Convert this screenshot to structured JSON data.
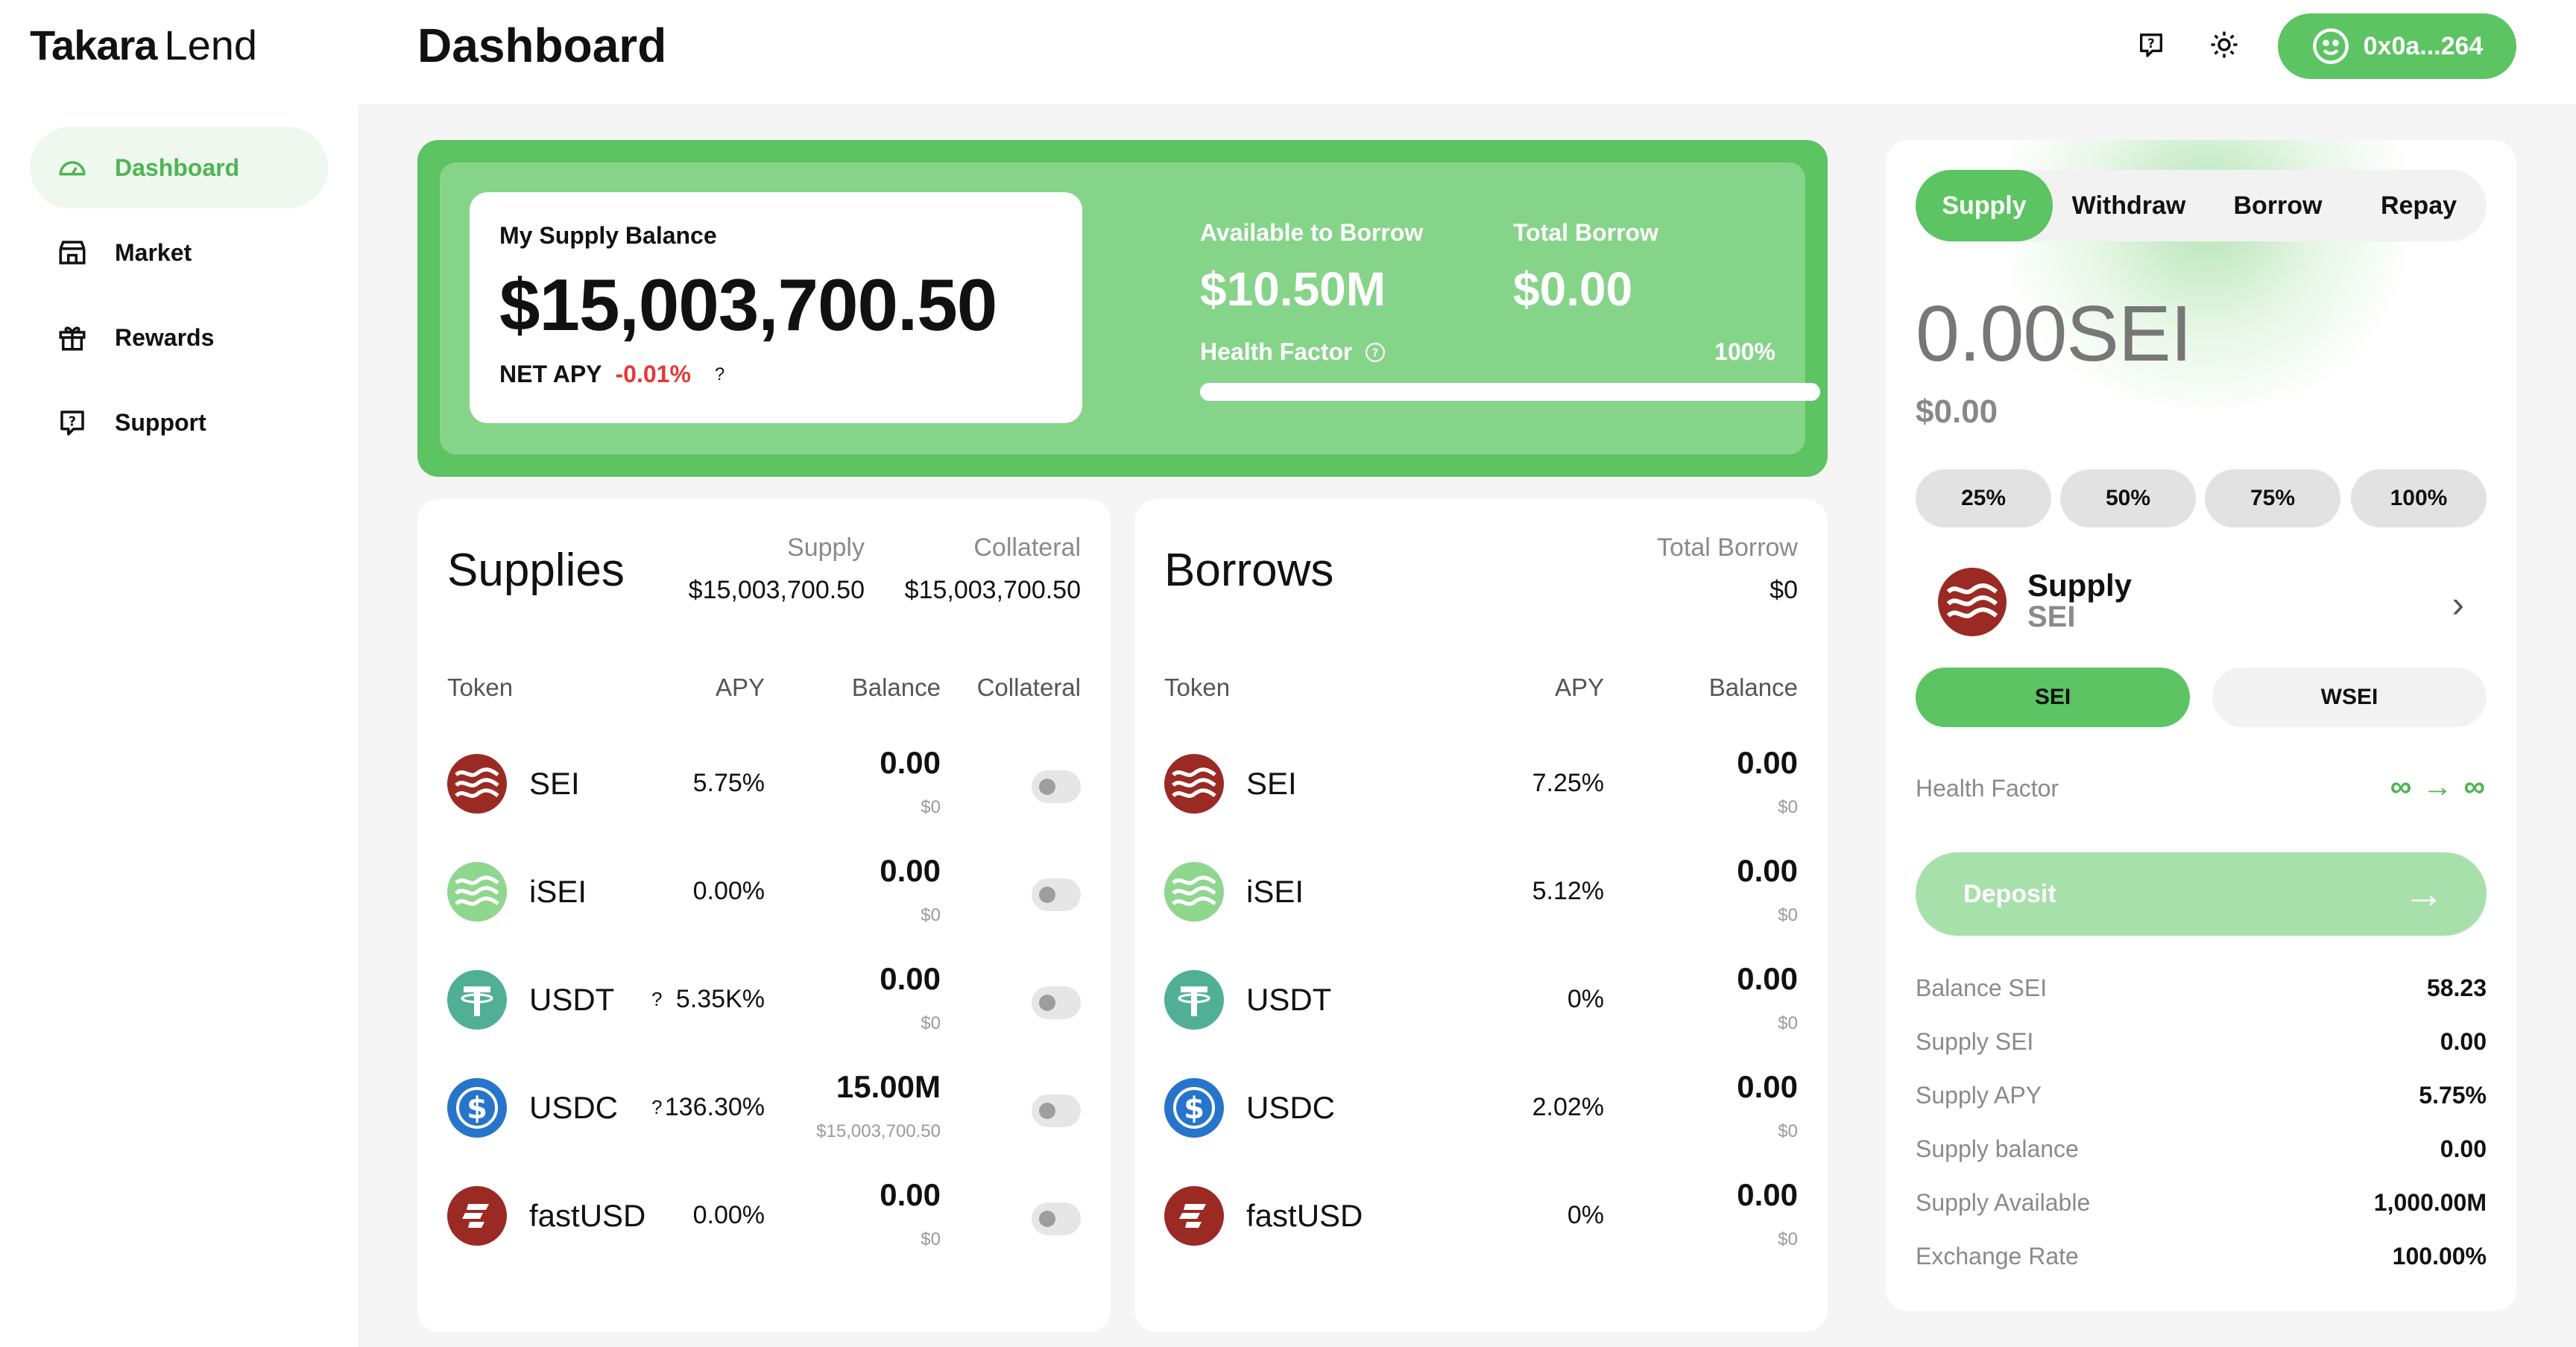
{
  "brand": {
    "bold": "Takara",
    "light": "Lend"
  },
  "header": {
    "title": "Dashboard",
    "wallet": "0x0a...264"
  },
  "sidebar": {
    "items": [
      {
        "label": "Dashboard",
        "icon": "gauge-icon",
        "active": true
      },
      {
        "label": "Market",
        "icon": "store-icon",
        "active": false
      },
      {
        "label": "Rewards",
        "icon": "gift-icon",
        "active": false
      },
      {
        "label": "Support",
        "icon": "help-icon",
        "active": false
      }
    ]
  },
  "hero": {
    "supply_label": "My Supply Balance",
    "supply_value": "$15,003,700.50",
    "net_apy_label": "NET APY",
    "net_apy_value": "-0.01%",
    "net_apy_q": "?",
    "available_label": "Available to Borrow",
    "available_value": "$10.50M",
    "total_borrow_label": "Total Borrow",
    "total_borrow_value": "$0.00",
    "health_label": "Health Factor",
    "health_pct": "100%",
    "health_fraction": 1.0
  },
  "supplies": {
    "title": "Supplies",
    "supply_h": "Supply",
    "supply_v": "$15,003,700.50",
    "collateral_h": "Collateral",
    "collateral_v": "$15,003,700.50",
    "columns": [
      "Token",
      "APY",
      "Balance",
      "Collateral"
    ],
    "rows": [
      {
        "token": "SEI",
        "q": "",
        "apy": "5.75%",
        "amount": "0.00",
        "usd": "$0"
      },
      {
        "token": "iSEI",
        "q": "",
        "apy": "0.00%",
        "amount": "0.00",
        "usd": "$0"
      },
      {
        "token": "USDT",
        "q": "?",
        "apy": "5.35K%",
        "amount": "0.00",
        "usd": "$0"
      },
      {
        "token": "USDC",
        "q": "?",
        "apy": "136.30%",
        "amount": "15.00M",
        "usd": "$15,003,700.50"
      },
      {
        "token": "fastUSD",
        "q": "",
        "apy": "0.00%",
        "amount": "0.00",
        "usd": "$0"
      }
    ]
  },
  "borrows": {
    "title": "Borrows",
    "total_h": "Total Borrow",
    "total_v": "$0",
    "columns": [
      "Token",
      "APY",
      "Balance"
    ],
    "rows": [
      {
        "token": "SEI",
        "apy": "7.25%",
        "amount": "0.00",
        "usd": "$0"
      },
      {
        "token": "iSEI",
        "apy": "5.12%",
        "amount": "0.00",
        "usd": "$0"
      },
      {
        "token": "USDT",
        "apy": "0%",
        "amount": "0.00",
        "usd": "$0"
      },
      {
        "token": "USDC",
        "apy": "2.02%",
        "amount": "0.00",
        "usd": "$0"
      },
      {
        "token": "fastUSD",
        "apy": "0%",
        "amount": "0.00",
        "usd": "$0"
      }
    ]
  },
  "action": {
    "tabs": [
      "Supply",
      "Withdraw",
      "Borrow",
      "Repay"
    ],
    "amount": "0.00SEI",
    "amount_usd": "$0.00",
    "pcts": [
      "25%",
      "50%",
      "75%",
      "100%"
    ],
    "asset_title": "Supply",
    "asset_sub": "SEI",
    "seg": [
      "SEI",
      "WSEI"
    ],
    "health_label": "Health Factor",
    "health_value": "∞ → ∞",
    "deposit": "Deposit",
    "details": [
      {
        "k": "Balance SEI",
        "v": "58.23"
      },
      {
        "k": "Supply SEI",
        "v": "0.00"
      },
      {
        "k": "Supply APY",
        "v": "5.75%"
      },
      {
        "k": "Supply balance",
        "v": "0.00"
      },
      {
        "k": "Supply Available",
        "v": "1,000.00M"
      },
      {
        "k": "Exchange Rate",
        "v": "100.00%"
      }
    ]
  },
  "colors": {
    "green": "#5cc462",
    "light_green": "#86d48a",
    "sei_red": "#9b2a24",
    "isei_green": "#8fd68f",
    "usdt": "#50af95",
    "usdc": "#2775ca",
    "negative": "#e53935"
  }
}
